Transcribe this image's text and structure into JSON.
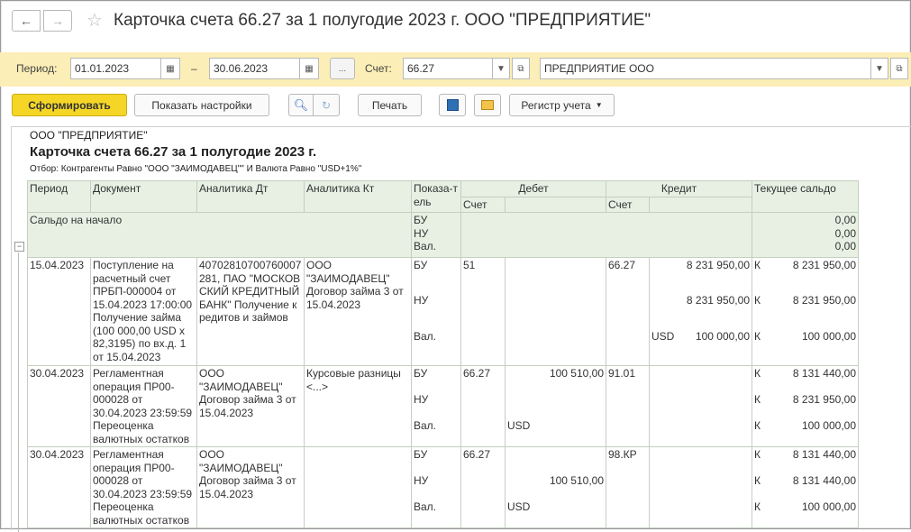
{
  "window": {
    "title": "Карточка счета 66.27 за 1 полугодие 2023 г. ООО \"ПРЕДПРИЯТИЕ\""
  },
  "filter": {
    "period_label": "Период:",
    "date_from": "01.01.2023",
    "dash": "–",
    "date_to": "30.06.2023",
    "dots": "...",
    "account_label": "Счет:",
    "account": "66.27",
    "organization": "ПРЕДПРИЯТИЕ ООО"
  },
  "toolbar": {
    "generate": "Сформировать",
    "settings": "Показать настройки",
    "print": "Печать",
    "register": "Регистр учета"
  },
  "report": {
    "org": "ООО \"ПРЕДПРИЯТИЕ\"",
    "title": "Карточка счета 66.27 за 1 полугодие 2023 г.",
    "filter_text": "Отбор: Контрагенты Равно \"ООО \"ЗАИМОДАВЕЦ\"\" И Валюта Равно \"USD+1%\"",
    "headers": {
      "period": "Период",
      "document": "Документ",
      "an_dt": "Аналитика Дт",
      "an_kt": "Аналитика Кт",
      "indicator": "Показа-тель",
      "debit": "Дебет",
      "credit": "Кредит",
      "balance": "Текущее сальдо",
      "account": "Счет"
    },
    "opening": {
      "label": "Сальдо на начало",
      "ind": [
        "БУ",
        "НУ",
        "Вал."
      ],
      "values": [
        "0,00",
        "0,00",
        "0,00"
      ]
    },
    "rows": [
      {
        "period": "15.04.2023",
        "document": "Поступление на расчетный счет ПРБП-000004 от 15.04.2023 17:00:00 Получение займа (100 000,00 USD x 82,3195) по вх.д. 1 от 15.04.2023",
        "an_dt": "40702810700760007281, ПАО \"МОСКОВСКИЙ КРЕДИТНЫЙ БАНК\" Получение кредитов и займов",
        "an_kt": "ООО \"ЗАИМОДАВЕЦ\" Договор займа 3 от 15.04.2023",
        "ind": [
          "БУ",
          "НУ",
          "Вал."
        ],
        "dt_acc": "51",
        "dt_sum": [
          "",
          "",
          ""
        ],
        "kt_acc": "66.27",
        "kt_sum": [
          "8 231 950,00",
          "8 231 950,00",
          "100 000,00"
        ],
        "kt_cur": "USD",
        "dk": [
          "К",
          "К",
          "К"
        ],
        "bal": [
          "8 231 950,00",
          "8 231 950,00",
          "100 000,00"
        ]
      },
      {
        "period": "30.04.2023",
        "document": "Регламентная операция ПР00-000028 от 30.04.2023 23:59:59 Переоценка валютных остатков",
        "an_dt": "ООО \"ЗАИМОДАВЕЦ\" Договор займа 3 от 15.04.2023",
        "an_kt": "Курсовые разницы <...>",
        "ind": [
          "БУ",
          "НУ",
          "Вал."
        ],
        "dt_acc": "66.27",
        "dt_sum": [
          "100 510,00",
          "",
          ""
        ],
        "dt_cur": "USD",
        "kt_acc": "91.01",
        "kt_sum": [
          "",
          "",
          ""
        ],
        "dk": [
          "К",
          "К",
          "К"
        ],
        "bal": [
          "8 131 440,00",
          "8 231 950,00",
          "100 000,00"
        ]
      },
      {
        "period": "30.04.2023",
        "document": "Регламентная операция ПР00-000028 от 30.04.2023 23:59:59 Переоценка валютных остатков",
        "an_dt": "ООО \"ЗАИМОДАВЕЦ\" Договор займа 3 от 15.04.2023",
        "an_kt": "",
        "ind": [
          "БУ",
          "НУ",
          "Вал."
        ],
        "dt_acc": "66.27",
        "dt_sum": [
          "",
          "100 510,00",
          ""
        ],
        "dt_cur": "USD",
        "kt_acc": "98.КР",
        "kt_sum": [
          "",
          "",
          ""
        ],
        "dk": [
          "К",
          "К",
          "К"
        ],
        "bal": [
          "8 131 440,00",
          "8 131 440,00",
          "100 000,00"
        ]
      }
    ]
  }
}
